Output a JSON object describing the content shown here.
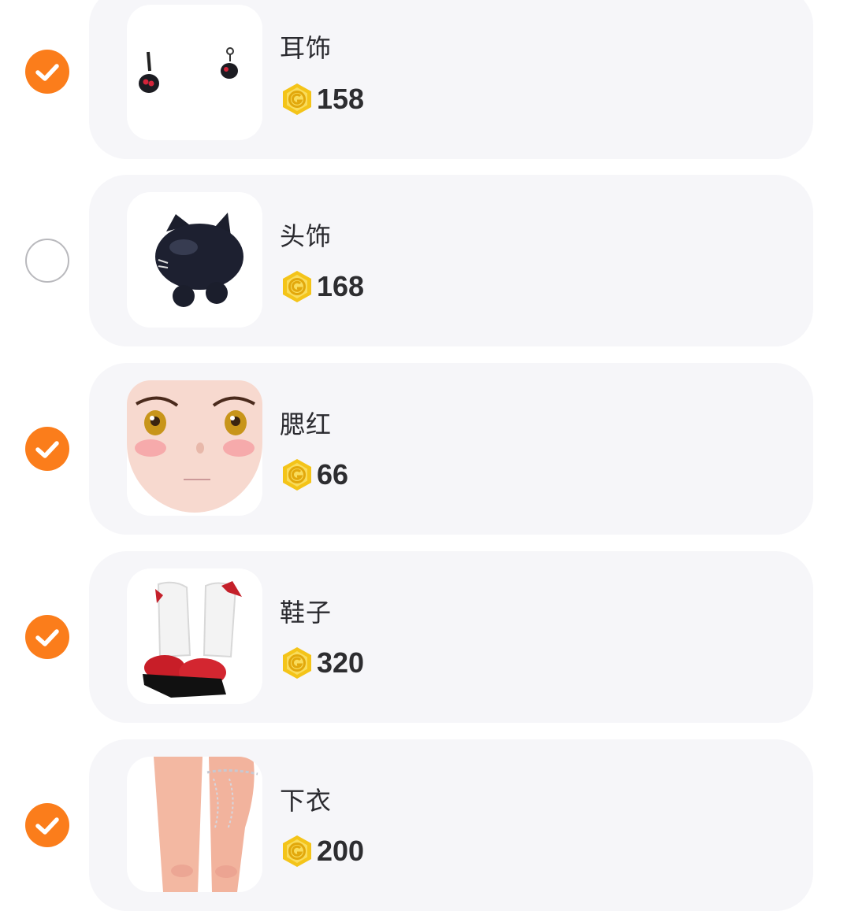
{
  "items": [
    {
      "name": "耳饰",
      "price": "158",
      "selected": true,
      "thumb_icon": "earrings-icon"
    },
    {
      "name": "头饰",
      "price": "168",
      "selected": false,
      "thumb_icon": "cat-head-accessory-icon"
    },
    {
      "name": "腮红",
      "price": "66",
      "selected": true,
      "thumb_icon": "anime-face-blush-icon"
    },
    {
      "name": "鞋子",
      "price": "320",
      "selected": true,
      "thumb_icon": "fur-boots-icon"
    },
    {
      "name": "下衣",
      "price": "200",
      "selected": true,
      "thumb_icon": "legs-bottomwear-icon"
    }
  ],
  "colors": {
    "check_on": "#fb7d1b",
    "coin": "#f2c217",
    "card_bg": "#f6f6f9"
  }
}
